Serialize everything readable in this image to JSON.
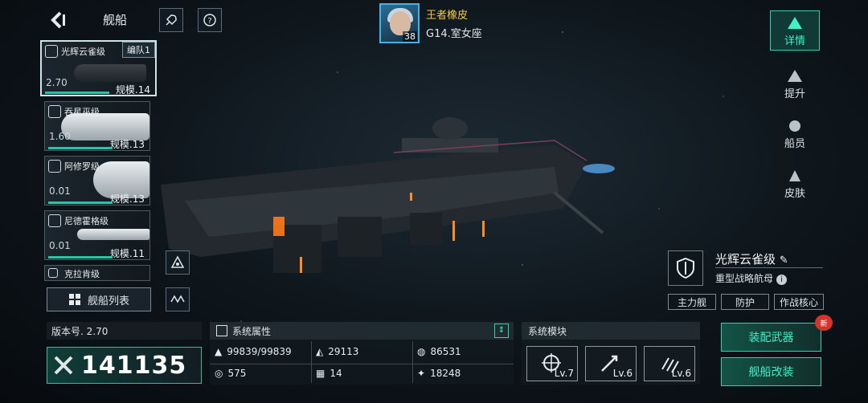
{
  "header": {
    "title": "舰船"
  },
  "player": {
    "name": "王者橡皮",
    "zone": "G14.室女座",
    "level": "38"
  },
  "ships": [
    {
      "name": "光辉云雀级",
      "fleet": "编队1",
      "version": "2.70",
      "scale": "规模.14"
    },
    {
      "name": "吞星巫级",
      "version": "1.60",
      "scale": "规模.13"
    },
    {
      "name": "阿修罗级",
      "version": "0.01",
      "scale": "规模.13"
    },
    {
      "name": "尼德霍格级",
      "version": "0.01",
      "scale": "规模.11"
    },
    {
      "name": "克拉肯级"
    }
  ],
  "ship_list": {
    "label": "舰船列表"
  },
  "nav": [
    "详情",
    "提升",
    "船员",
    "皮肤"
  ],
  "ship_info": {
    "name": "光辉云雀级",
    "type": "重型战略航母",
    "tags": [
      "主力舰",
      "防护",
      "作战核心"
    ]
  },
  "bottom": {
    "version_label": "版本号. 2.70",
    "power": "141135"
  },
  "attributes": {
    "title": "系统属性",
    "items": [
      "99839/99839",
      "29113",
      "86531",
      "575",
      "14",
      "18248"
    ]
  },
  "modules": {
    "title": "系统模块",
    "items": [
      "Lv.7",
      "Lv.6",
      "Lv.6"
    ]
  },
  "actions": {
    "equip": "装配武器",
    "modify": "舰船改装",
    "new_badge": "新"
  },
  "colors": {
    "accent": "#42f0c7",
    "player_name": "#f2c94c",
    "badge": "#d8332a"
  }
}
